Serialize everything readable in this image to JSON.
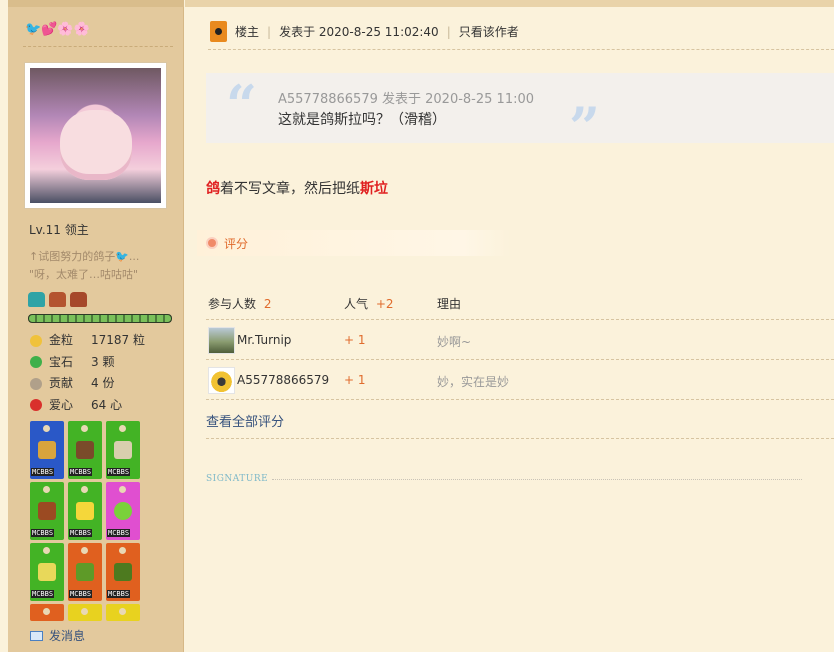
{
  "profile": {
    "emoji": "🐦💕🌸🌸",
    "level": "Lv.11 领主",
    "custom_title_line1": "↑试图努力的鸽子🐦...",
    "custom_title_line2": "\"呀，太难了…咕咕咕\"",
    "level_progress": 1.0,
    "stats": [
      {
        "label": "金粒",
        "value": "17187 粒",
        "icon": "gold-nugget-icon",
        "color": "#f0c23b"
      },
      {
        "label": "宝石",
        "value": "3 颗",
        "icon": "emerald-icon",
        "color": "#3fb04a"
      },
      {
        "label": "贡献",
        "value": "4 份",
        "icon": "contribution-icon",
        "color": "#b0a08a"
      },
      {
        "label": "爱心",
        "value": "64 心",
        "icon": "heart-apple-icon",
        "color": "#d9302c"
      }
    ],
    "badge_tag": "MCBBS",
    "send_message": "发消息"
  },
  "post": {
    "owner_label": "楼主",
    "posted_at": "发表于 2020-8-25 11:02:40",
    "only_author": "只看该作者",
    "quote": {
      "meta": "A55778866579 发表于 2020-8-25 11:00",
      "text": "这就是鸽斯拉吗？（滑稽）"
    },
    "content": {
      "part1": "鸽",
      "part2": "着不写文章，然后把纸",
      "part3": "斯垃"
    },
    "rate_tab": "评分",
    "rating": {
      "participants_label": "参与人数",
      "participants": "2",
      "popularity_label": "人气",
      "popularity": "+2",
      "reason_label": "理由",
      "rows": [
        {
          "user": "Mr.Turnip",
          "points": "+ 1",
          "reason": "妙啊~"
        },
        {
          "user": "A55778866579",
          "points": "+ 1",
          "reason": "妙，实在是妙"
        }
      ],
      "view_all": "查看全部评分"
    },
    "signature_label": "SIGNATURE"
  },
  "colors": {
    "accent_orange": "#e06b2c",
    "link_blue": "#36527d",
    "sidebar_bg": "#e3c99d",
    "page_bg": "#fbf2db"
  }
}
